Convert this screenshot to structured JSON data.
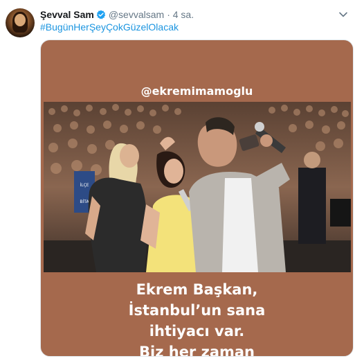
{
  "tweet": {
    "author_name": "Şevval Sam",
    "verified": true,
    "handle": "@sevvalsam",
    "timestamp": "· 4 sa.",
    "hashtag": "#BugünHerŞeyÇokGüzelOlacak"
  },
  "media": {
    "mention": "@ekremimamoglu",
    "caption_lines": [
      "Ekrem Başkan,",
      "İstanbul’un sana",
      "ihtiyacı var.",
      "Biz her zaman"
    ],
    "sign_text": [
      "İLÇE",
      "BİTA"
    ],
    "background_color": "#a5694d"
  },
  "icons": {
    "verified": "verified-badge-icon",
    "menu": "chevron-down-icon"
  },
  "colors": {
    "name": "#14171a",
    "secondary": "#657786",
    "link": "#1b95e0",
    "verified": "#1da1f2"
  }
}
